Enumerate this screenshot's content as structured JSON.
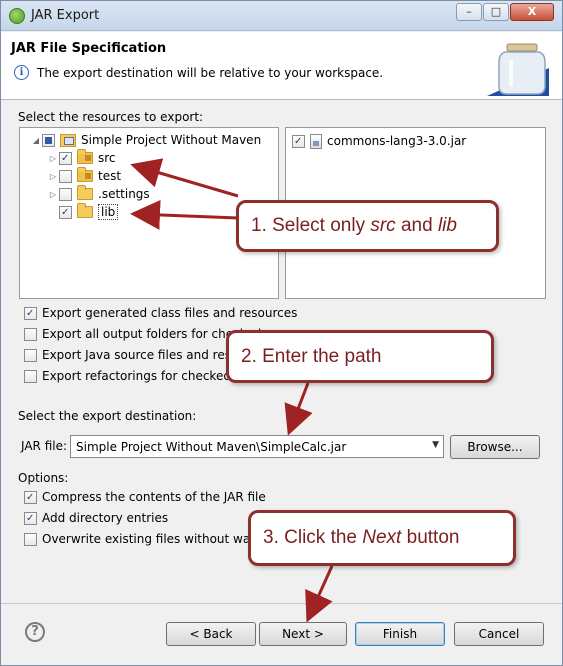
{
  "window": {
    "title": "JAR Export",
    "controls": {
      "minimize": "–",
      "maximize": "□",
      "close": "X"
    }
  },
  "header": {
    "title": "JAR File Specification",
    "message": "The export destination will be relative to your workspace.",
    "info_icon": "i"
  },
  "resources": {
    "label": "Select the resources to export:",
    "tree": [
      {
        "label": "Simple Project Without Maven",
        "state": "partial",
        "expanded": true
      },
      {
        "label": "src",
        "state": "checked"
      },
      {
        "label": "test",
        "state": "unchecked"
      },
      {
        "label": ".settings",
        "state": "unchecked"
      },
      {
        "label": "lib",
        "state": "checked"
      }
    ],
    "files": [
      {
        "label": "commons-lang3-3.0.jar",
        "state": "checked"
      }
    ]
  },
  "options_top": [
    {
      "label": "Export generated class files and resources",
      "checked": true
    },
    {
      "label": "Export all output folders for checked",
      "checked": false
    },
    {
      "label": "Export Java source files and resourc",
      "checked": false
    },
    {
      "label": "Export refactorings for checked proj",
      "checked": false
    }
  ],
  "destination": {
    "label": "Select the export destination:",
    "jar_file_label": "JAR file:",
    "jar_file_value": "Simple Project Without Maven\\SimpleCalc.jar",
    "browse_label": "Browse..."
  },
  "options": {
    "label": "Options:",
    "items": [
      {
        "label": "Compress the contents of the JAR file",
        "checked": true
      },
      {
        "label": "Add directory entries",
        "checked": true
      },
      {
        "label": "Overwrite existing files without warning",
        "checked": false
      }
    ]
  },
  "buttons": {
    "help": "?",
    "back": "< Back",
    "next": "Next >",
    "finish": "Finish",
    "cancel": "Cancel"
  },
  "callouts": {
    "step1_prefix": "1. Select only ",
    "step1_src": "src",
    "step1_and": " and ",
    "step1_lib": "lib",
    "step2": "2. Enter the path",
    "step3_prefix": "3. Click the ",
    "step3_next": "Next",
    "step3_suffix": " button"
  },
  "colors": {
    "callout_border": "#8b2f2f",
    "callout_text": "#7a1f1f",
    "arrow": "#a02222"
  }
}
